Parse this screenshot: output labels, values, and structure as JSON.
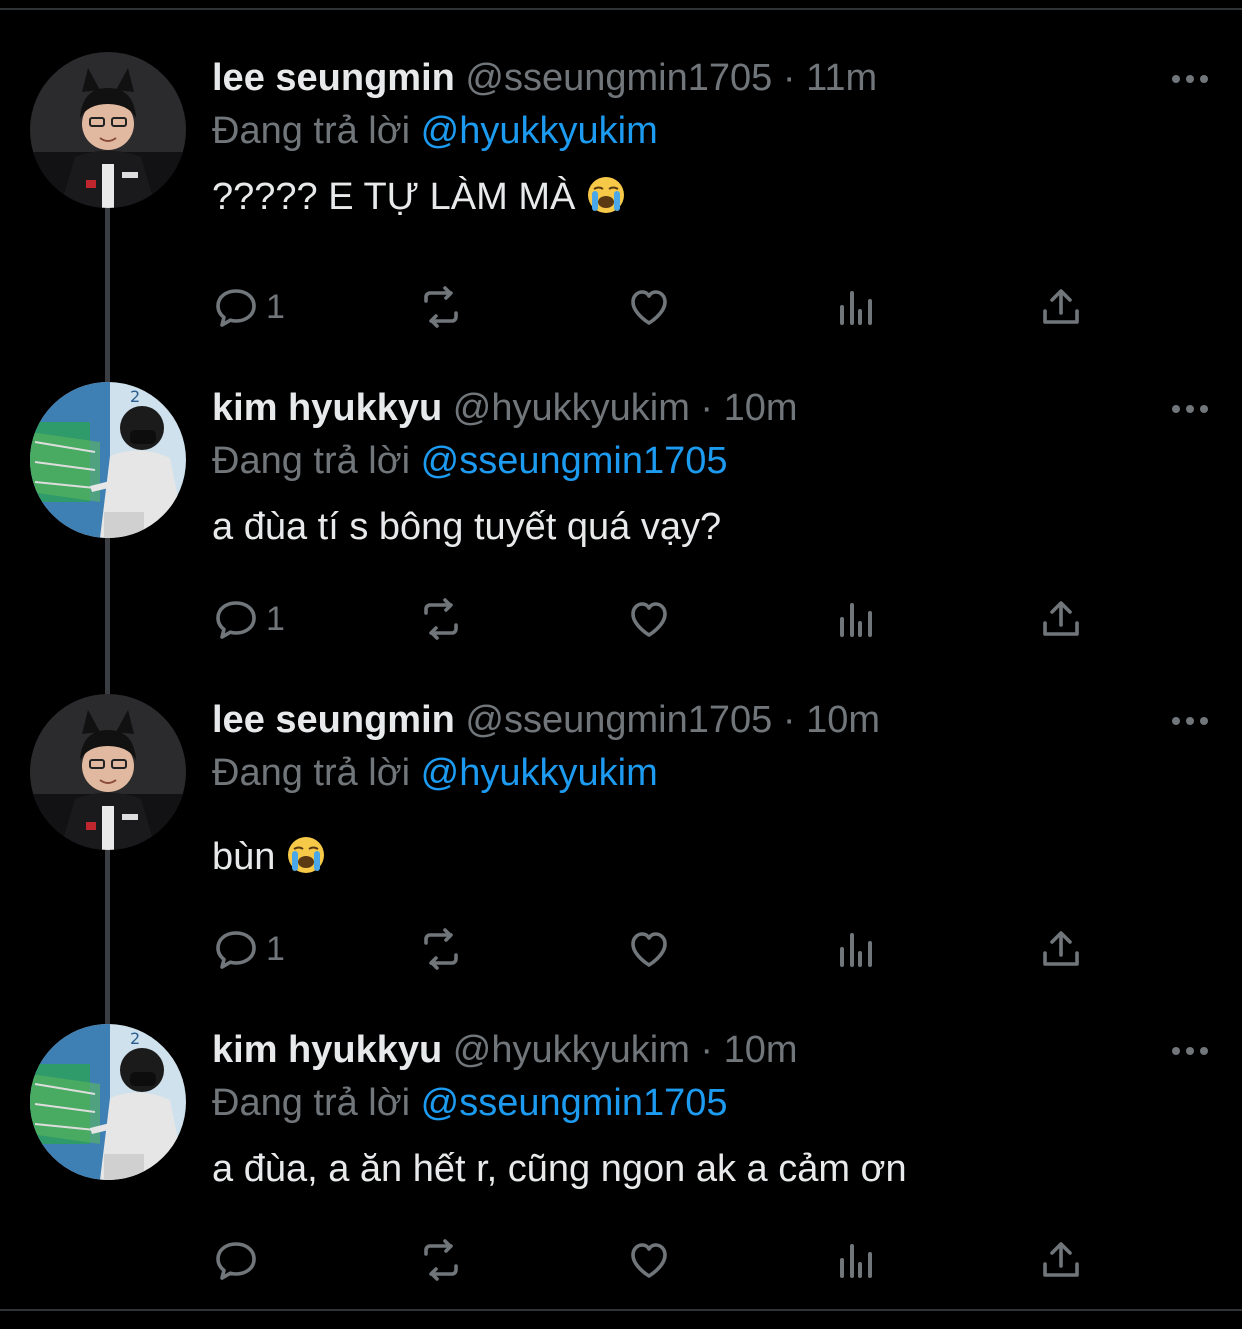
{
  "tweets": [
    {
      "name": "lee seungmin",
      "handle": "@sseungmin1705",
      "sep": "·",
      "time": "11m",
      "reply_prefix": "Đang trả lời",
      "reply_to": "@hyukkyukim",
      "text": "????? E TỰ LÀM MÀ",
      "emoji": "crying-face",
      "reply_count": "1",
      "avatar": "avatar-seungmin"
    },
    {
      "name": "kim hyukkyu",
      "handle": "@hyukkyukim",
      "sep": "·",
      "time": "10m",
      "reply_prefix": "Đang trả lời",
      "reply_to": "@sseungmin1705",
      "text": "a đùa tí s bông tuyết quá vạy?",
      "emoji": "",
      "reply_count": "1",
      "avatar": "avatar-hyukkyu"
    },
    {
      "name": "lee seungmin",
      "handle": "@sseungmin1705",
      "sep": "·",
      "time": "10m",
      "reply_prefix": "Đang trả lời",
      "reply_to": "@hyukkyukim",
      "text": "bùn",
      "emoji": "crying-face",
      "reply_count": "1",
      "avatar": "avatar-seungmin"
    },
    {
      "name": "kim hyukkyu",
      "handle": "@hyukkyukim",
      "sep": "·",
      "time": "10m",
      "reply_prefix": "Đang trả lời",
      "reply_to": "@sseungmin1705",
      "text": "a đùa, a ăn hết r, cũng ngon ak a cảm ơn",
      "emoji": "",
      "reply_count": "",
      "avatar": "avatar-hyukkyu"
    }
  ],
  "colors": {
    "background": "#000000",
    "text": "#e7e9ea",
    "muted": "#71767b",
    "mention": "#1d9bf0",
    "thread_line": "#3a3d41"
  },
  "icons": [
    "reply-icon",
    "retweet-icon",
    "like-icon",
    "views-icon",
    "share-icon",
    "more-icon"
  ]
}
